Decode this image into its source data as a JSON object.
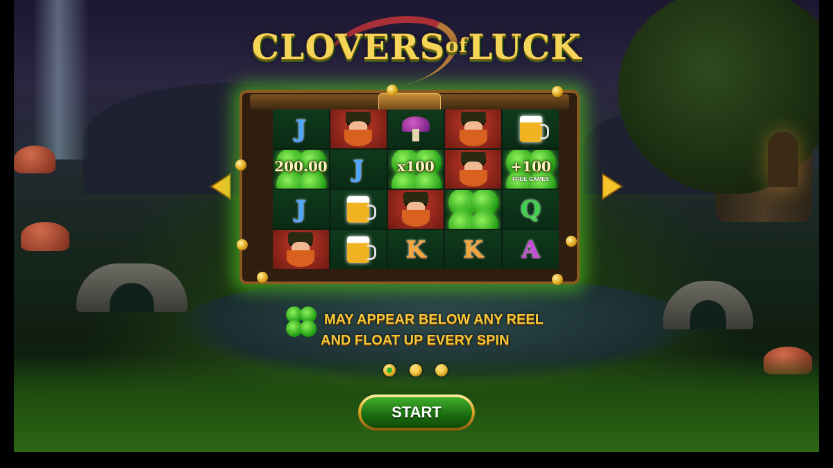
{
  "logo": {
    "part1": "CLOVERS",
    "part2": "of",
    "part3": "LUCK"
  },
  "reels": {
    "cells": [
      [
        "J",
        "leprechaun",
        "mushroom",
        "leprechaun",
        "beer"
      ],
      [
        "clover-200",
        "J",
        "clover-x100",
        "leprechaun",
        "clover-free"
      ],
      [
        "J",
        "beer",
        "leprechaun",
        "clover",
        "Q"
      ],
      [
        "leprechaun",
        "beer",
        "K",
        "K",
        "A"
      ]
    ],
    "clover_value_1": "200.00",
    "clover_value_2": "x100",
    "clover_value_3": "+100",
    "clover_value_3_sub": "FREE GAMES"
  },
  "nav": {
    "prev_icon": "chevron-left-icon",
    "next_icon": "chevron-right-icon"
  },
  "feature": {
    "line1": "MAY APPEAR BELOW ANY REEL",
    "line2": "AND FLOAT UP EVERY SPIN"
  },
  "pagination": {
    "total": 3,
    "active_index": 0
  },
  "start_button": {
    "label": "START"
  },
  "colors": {
    "gold": "#f7c93a",
    "green": "#2fb52a",
    "glow": "#5adc1e"
  }
}
